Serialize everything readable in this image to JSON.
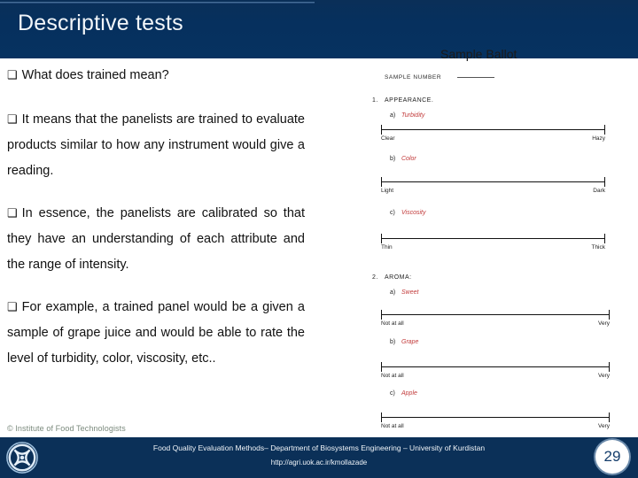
{
  "header": {
    "title": "Descriptive tests"
  },
  "content": {
    "bullet_mark": "❑",
    "paragraphs": [
      "What does trained mean?",
      "It means that the panelists are trained to evaluate products similar to how any instrument would give a reading.",
      "In essence, the panelists are calibrated so that they have an understanding of each attribute and the range of intensity.",
      "For example, a trained panel would be a given a sample of grape juice and would be able to rate the level of turbidity, color, viscosity, etc.."
    ],
    "credit": "© Institute of Food Technologists"
  },
  "ballot": {
    "title": "Sample Ballot",
    "sample_number_label": "SAMPLE NUMBER",
    "sections": [
      {
        "number": "1.",
        "name": "APPEARANCE.",
        "items": [
          {
            "letter": "a)",
            "attribute": "Turbidity",
            "left_anchor": "Clear",
            "right_anchor": "Hazy"
          },
          {
            "letter": "b)",
            "attribute": "Color",
            "left_anchor": "Light",
            "right_anchor": "Dark"
          },
          {
            "letter": "c)",
            "attribute": "Viscosity",
            "left_anchor": "Thin",
            "right_anchor": "Thick"
          }
        ]
      },
      {
        "number": "2.",
        "name": "AROMA:",
        "items": [
          {
            "letter": "a)",
            "attribute": "Sweet",
            "left_anchor": "Not at all",
            "right_anchor": "Very"
          },
          {
            "letter": "b)",
            "attribute": "Grape",
            "left_anchor": "Not at all",
            "right_anchor": "Very"
          },
          {
            "letter": "c)",
            "attribute": "Apple",
            "left_anchor": "Not at all",
            "right_anchor": "Very"
          }
        ]
      }
    ]
  },
  "footer": {
    "text": "Food Quality Evaluation Methods– Department of Biosystems Engineering – University of Kurdistan",
    "url": "http://agri.uok.ac.ir/kmollazade",
    "page_number": "29"
  },
  "colors": {
    "header_blue": "#06305e",
    "footer_blue": "#0b3058",
    "attribute_red": "#c23b3b",
    "credit_gray": "#7b8a7d"
  }
}
